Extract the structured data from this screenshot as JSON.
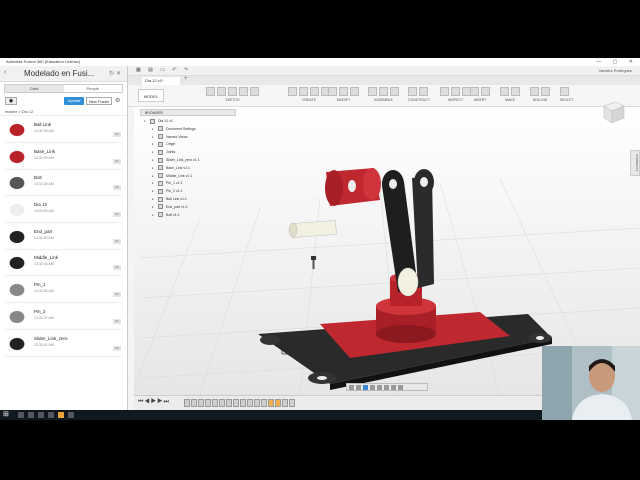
{
  "window": {
    "title": "Autodesk Fusion 360 (Education License)"
  },
  "data_panel": {
    "title": "Modelado en Fusi...",
    "tabs": [
      "Data",
      "People"
    ],
    "upload_label": "Upload",
    "new_folder_label": "New Folder",
    "breadcrumb": "master  >  Dia 12",
    "files": [
      {
        "name": "Ball Link",
        "time": "12:32:39 AM",
        "version": "V1",
        "thumb_color": "#b8232a"
      },
      {
        "name": "Base_Link",
        "time": "12:32:29 AM",
        "version": "V1",
        "thumb_color": "#b8232a"
      },
      {
        "name": "Bolt",
        "time": "12:32:25 AM",
        "version": "V1",
        "thumb_color": "#555555"
      },
      {
        "name": "Dia 12",
        "time": "12:53:00 AM",
        "version": "V1",
        "thumb_color": "#eeeeee"
      },
      {
        "name": "End_part",
        "time": "12:32:30 AM",
        "version": "V1",
        "thumb_color": "#222222"
      },
      {
        "name": "Middle_Link",
        "time": "12:32:43 AM",
        "version": "V1",
        "thumb_color": "#222222"
      },
      {
        "name": "Pin_1",
        "time": "12:32:35 AM",
        "version": "V1",
        "thumb_color": "#888888"
      },
      {
        "name": "Pin_2",
        "time": "12:32:37 AM",
        "version": "V1",
        "thumb_color": "#888888"
      },
      {
        "name": "Slider_Link_zero",
        "time": "12:32:41 AM",
        "version": "V1",
        "thumb_color": "#222222"
      }
    ]
  },
  "topbar": {
    "user": "Vanales Rodriguez"
  },
  "doc_tab": {
    "label": "Dia 12 v1*"
  },
  "ribbon": {
    "workspace": "MODEL",
    "groups": [
      "SKETCH",
      "CREATE",
      "MODIFY",
      "ASSEMBLE",
      "CONSTRUCT",
      "INSPECT",
      "INSERT",
      "MAKE",
      "ADD-INS",
      "SELECT"
    ]
  },
  "browser": {
    "header": "BROWSER",
    "items": [
      {
        "label": "Dia 12 v1",
        "indent": 0
      },
      {
        "label": "Document Settings",
        "indent": 1
      },
      {
        "label": "Named Views",
        "indent": 1
      },
      {
        "label": "Origin",
        "indent": 1
      },
      {
        "label": "Joints",
        "indent": 1
      },
      {
        "label": "Slider_Link_zero v1:1",
        "indent": 1
      },
      {
        "label": "Base_Link v1:1",
        "indent": 1
      },
      {
        "label": "Middle_Link v1:1",
        "indent": 1
      },
      {
        "label": "Pin_1 v1:1",
        "indent": 1
      },
      {
        "label": "Pin_2 v1:1",
        "indent": 1
      },
      {
        "label": "Ball Link v1:1",
        "indent": 1
      },
      {
        "label": "End_part v1:1",
        "indent": 1
      },
      {
        "label": "Bolt v1:1",
        "indent": 1
      }
    ]
  },
  "comments_label": "COMMENTS",
  "colors": {
    "accent": "#2e8fd8",
    "part_red": "#b8232a",
    "part_dark": "#222222"
  }
}
